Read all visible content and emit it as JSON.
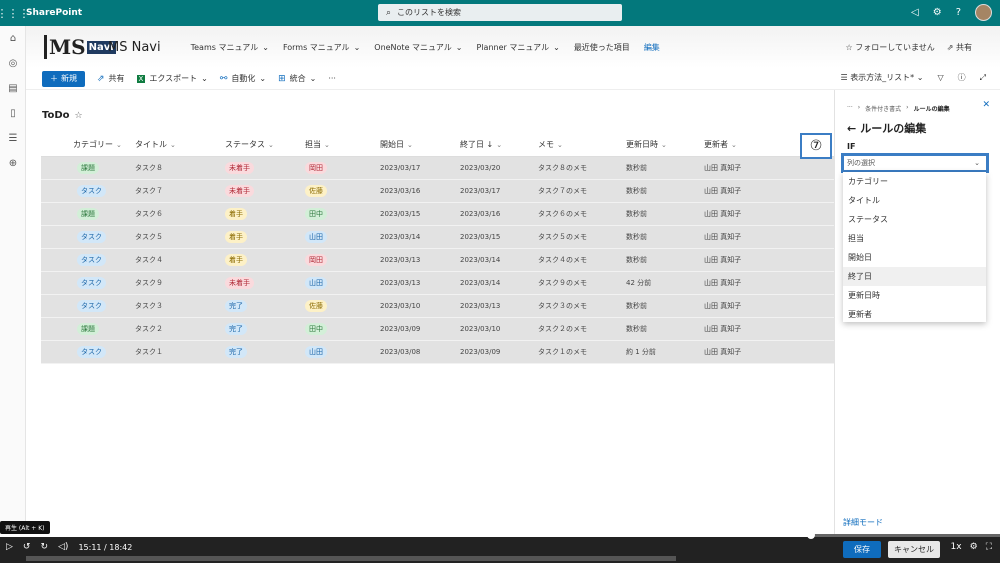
{
  "topbar": {
    "brand": "SharePoint",
    "search_placeholder": "このリストを検索"
  },
  "site": {
    "name": "MS Navi",
    "logo_m": "MS",
    "logo_navi": "Navi",
    "nav": [
      {
        "label": "Teams マニュアル"
      },
      {
        "label": "Forms マニュアル"
      },
      {
        "label": "OneNote マニュアル"
      },
      {
        "label": "Planner マニュアル"
      },
      {
        "label": "最近使った項目"
      }
    ],
    "edit_label": "編集",
    "follow_label": "フォローしていません",
    "share_label": "共有"
  },
  "commands": {
    "new": "新規",
    "share": "共有",
    "export": "エクスポート",
    "automate": "自動化",
    "integrate": "統合",
    "more": "···",
    "view": "表示方法_リスト*"
  },
  "list": {
    "title": "ToDo",
    "columns": [
      "カテゴリー",
      "タイトル",
      "ステータス",
      "担当",
      "開始日",
      "終了日 ↓",
      "メモ",
      "更新日時",
      "更新者"
    ],
    "rows": [
      {
        "category": "課題",
        "cat": "tag",
        "title": "タスク８",
        "status": "未着手",
        "st": "todo",
        "assignee": "岡田",
        "as": "oka",
        "start": "2023/03/17",
        "end": "2023/03/20",
        "memo": "タスク８のメモ",
        "modified": "数秒前",
        "editor": "山田 真知子"
      },
      {
        "category": "タスク",
        "cat": "task",
        "title": "タスク７",
        "status": "未着手",
        "st": "todo",
        "assignee": "佐藤",
        "as": "sato",
        "start": "2023/03/16",
        "end": "2023/03/17",
        "memo": "タスク７のメモ",
        "modified": "数秒前",
        "editor": "山田 真知子"
      },
      {
        "category": "課題",
        "cat": "tag",
        "title": "タスク６",
        "status": "着手",
        "st": "doing",
        "assignee": "田中",
        "as": "tanaka",
        "start": "2023/03/15",
        "end": "2023/03/16",
        "memo": "タスク６のメモ",
        "modified": "数秒前",
        "editor": "山田 真知子"
      },
      {
        "category": "タスク",
        "cat": "task",
        "title": "タスク５",
        "status": "着手",
        "st": "doing",
        "assignee": "山田",
        "as": "yama",
        "start": "2023/03/14",
        "end": "2023/03/15",
        "memo": "タスク５のメモ",
        "modified": "数秒前",
        "editor": "山田 真知子"
      },
      {
        "category": "タスク",
        "cat": "task",
        "title": "タスク４",
        "status": "着手",
        "st": "doing",
        "assignee": "岡田",
        "as": "oka",
        "start": "2023/03/13",
        "end": "2023/03/14",
        "memo": "タスク４のメモ",
        "modified": "数秒前",
        "editor": "山田 真知子"
      },
      {
        "category": "タスク",
        "cat": "task",
        "title": "タスク９",
        "status": "未着手",
        "st": "todo",
        "assignee": "山田",
        "as": "yama",
        "start": "2023/03/13",
        "end": "2023/03/14",
        "memo": "タスク９のメモ",
        "modified": "42 分前",
        "editor": "山田 真知子"
      },
      {
        "category": "タスク",
        "cat": "task",
        "title": "タスク３",
        "status": "完了",
        "st": "done",
        "assignee": "佐藤",
        "as": "sato",
        "start": "2023/03/10",
        "end": "2023/03/13",
        "memo": "タスク３のメモ",
        "modified": "数秒前",
        "editor": "山田 真知子"
      },
      {
        "category": "課題",
        "cat": "tag",
        "title": "タスク２",
        "status": "完了",
        "st": "done",
        "assignee": "田中",
        "as": "tanaka",
        "start": "2023/03/09",
        "end": "2023/03/10",
        "memo": "タスク２のメモ",
        "modified": "数秒前",
        "editor": "山田 真知子"
      },
      {
        "category": "タスク",
        "cat": "task",
        "title": "タスク１",
        "status": "完了",
        "st": "done",
        "assignee": "山田",
        "as": "yama",
        "start": "2023/03/08",
        "end": "2023/03/09",
        "memo": "タスク１のメモ",
        "modified": "約 1 分前",
        "editor": "山田 真知子"
      }
    ]
  },
  "panel": {
    "crumb_more": "···",
    "crumb_parent": "条件付き書式",
    "crumb_current": "ルールの編集",
    "title": "ルールの編集",
    "if_label": "IF",
    "step_marker": "⑦",
    "select_placeholder": "列の選択",
    "options": [
      "カテゴリー",
      "タイトル",
      "ステータス",
      "担当",
      "開始日",
      "終了日",
      "更新日時",
      "更新者"
    ],
    "hovered_option": "終了日",
    "advanced_label": "詳細モード",
    "save": "保存",
    "cancel": "キャンセル"
  },
  "player": {
    "tooltip": "再生 (Alt + K)",
    "time": "15:11 / 18:42",
    "progress": 0.811,
    "speed": "1x"
  }
}
